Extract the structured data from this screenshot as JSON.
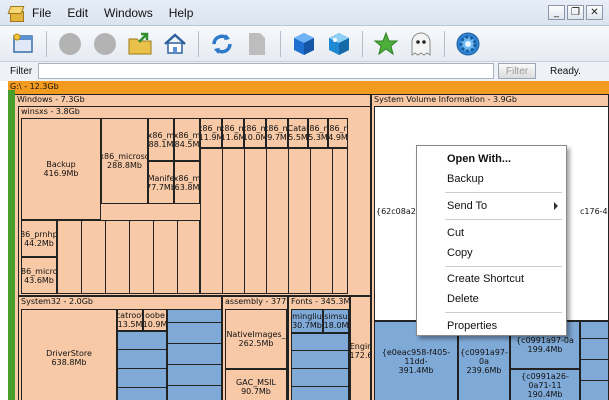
{
  "menu": {
    "file": "File",
    "edit": "Edit",
    "windows": "Windows",
    "help": "Help"
  },
  "window_controls": {
    "minimize": "_",
    "restore": "❐",
    "close": "✕"
  },
  "filter": {
    "label": "Filter",
    "value": "",
    "button": "Filter",
    "status": "Ready."
  },
  "root": {
    "title": "G:\\ - 12.3Gb"
  },
  "windows_group": {
    "title": "Windows - 7.3Gb"
  },
  "winsxs_group": {
    "title": "winsxs - 3.8Gb"
  },
  "system32_group": {
    "title": "System32 - 2.0Gb"
  },
  "assembly_group": {
    "title": "assembly - 377."
  },
  "fonts_group": {
    "title": "Fonts - 345.3M"
  },
  "svi_group": {
    "title": "System Volume Information - 3.9Gb"
  },
  "cells": {
    "backup": [
      "Backup",
      "416.9Mb"
    ],
    "x86_microso": [
      "x86_microso",
      "288.8Mb"
    ],
    "x86_m1": [
      "x86_m",
      "88.1M"
    ],
    "x86_m2": [
      "x86_m",
      "84.5M"
    ],
    "manife": [
      "Manife",
      "77.7Mb"
    ],
    "x86_m3": [
      "x86_m",
      "63.8M"
    ],
    "x86_prnhp": [
      "x86_prnhp0",
      "44.2Mb"
    ],
    "x86_micros2": [
      "x86_micros",
      "43.6Mb"
    ],
    "c11_6": [
      "x86_m",
      "11.9M"
    ],
    "c11_6b": [
      "x86_m",
      "11.6M"
    ],
    "c10": [
      "x86_m",
      "10.0M"
    ],
    "c9_7": [
      "x86_m",
      "9.7M"
    ],
    "catal": [
      "Catal",
      "5.5M"
    ],
    "c5_3": [
      "x86_m",
      "5.3M"
    ],
    "c4_9": [
      "x86_m",
      "4.9M"
    ],
    "driverstore": [
      "DriverStore",
      "638.8Mb"
    ],
    "catroot": [
      "catroot",
      "13.5M"
    ],
    "oobe": [
      "oobe",
      "10.9M"
    ],
    "nativeimages": [
      "NativeImages_",
      "262.5Mb"
    ],
    "gac_msil": [
      "GAC_MSIL",
      "90.7Mb"
    ],
    "mingliu": [
      "mingliu",
      "30.7Mb"
    ],
    "simsun": [
      "simsu",
      "18.0M"
    ],
    "engine": [
      "Engin",
      "172.6"
    ],
    "e0eac": [
      "{e0eac958-f405-11dd-",
      "391.4Mb"
    ],
    "c0991a97": [
      "{c0991a97-0a",
      "239.6Mb"
    ],
    "c0991a97b": [
      "{c0991a97-0a",
      "199.4Mb"
    ],
    "c0991a26": [
      "{c0991a26-0a71-11",
      "190.4Mb"
    ],
    "c62c08": [
      "{62c08a2e-0",
      ""
    ],
    "c176": [
      "c176-4",
      ""
    ]
  },
  "context_menu": {
    "open_with": "Open With...",
    "backup": "Backup",
    "send_to": "Send To",
    "cut": "Cut",
    "copy": "Copy",
    "create_shortcut": "Create Shortcut",
    "delete": "Delete",
    "properties": "Properties"
  },
  "colors": {
    "root_orange": "#f39b1f",
    "folder_peach": "#f7c9a7",
    "file_blue": "#7fa9d6",
    "accent_green": "#4a9e2c"
  }
}
